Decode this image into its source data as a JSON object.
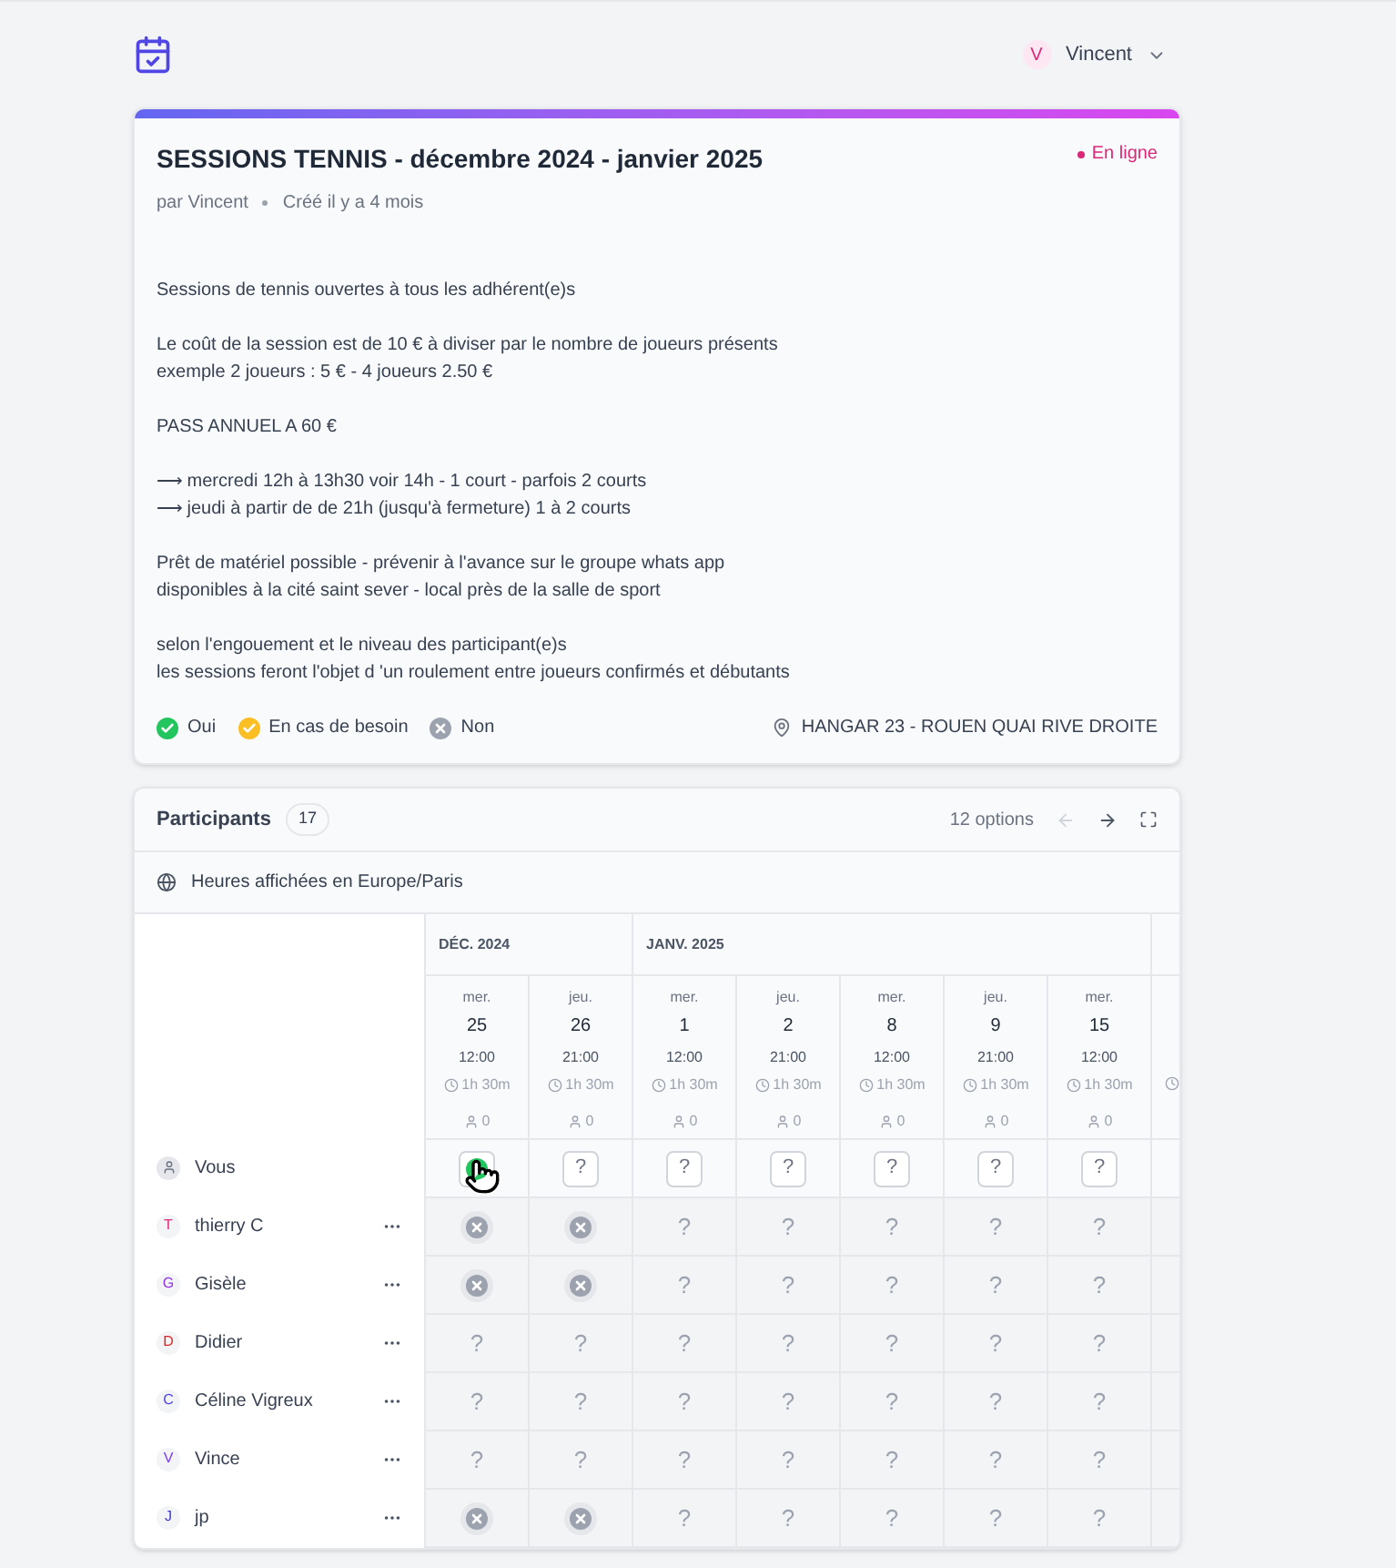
{
  "header": {
    "user": {
      "initial": "V",
      "name": "Vincent"
    }
  },
  "poll": {
    "title": "SESSIONS TENNIS - décembre 2024 - janvier 2025",
    "status": "En ligne",
    "author": "par Vincent",
    "created": "Créé il y a 4 mois",
    "description": [
      [
        "Sessions de tennis ouvertes à tous les adhérent(e)s"
      ],
      [
        "Le coût de la session est de 10 € à diviser par le nombre de joueurs présents",
        "exemple 2 joueurs : 5 € - 4 joueurs 2.50 €"
      ],
      [
        "PASS ANNUEL A 60 €"
      ],
      [
        "⟶ mercredi 12h à 13h30 voir 14h - 1 court - parfois 2 courts",
        "⟶ jeudi à partir de de 21h (jusqu'à fermeture) 1 à 2 courts"
      ],
      [
        "Prêt de matériel possible - prévenir à l'avance sur le groupe whats app",
        "disponibles à la cité saint sever - local près de la salle de sport"
      ],
      [
        "selon l'engouement et le niveau des participant(e)s",
        "les sessions feront l'objet d 'un roulement entre joueurs confirmés et débutants"
      ]
    ],
    "legend": [
      {
        "kind": "yes",
        "label": "Oui"
      },
      {
        "kind": "maybe",
        "label": "En cas de besoin"
      },
      {
        "kind": "no",
        "label": "Non"
      }
    ],
    "location": "HANGAR 23 - ROUEN QUAI RIVE DROITE"
  },
  "participants_panel": {
    "title": "Participants",
    "count": "17",
    "options_count": "12 options",
    "prev_disabled": true,
    "timezone": "Heures affichées en Europe/Paris",
    "months": [
      {
        "label": "DÉC. 2024",
        "options": [
          {
            "weekday": "mer.",
            "day": "25",
            "time": "12:00",
            "duration": "1h 30m",
            "attendees": "0"
          },
          {
            "weekday": "jeu.",
            "day": "26",
            "time": "21:00",
            "duration": "1h 30m",
            "attendees": "0"
          }
        ]
      },
      {
        "label": "JANV. 2025",
        "options": [
          {
            "weekday": "mer.",
            "day": "1",
            "time": "12:00",
            "duration": "1h 30m",
            "attendees": "0"
          },
          {
            "weekday": "jeu.",
            "day": "2",
            "time": "21:00",
            "duration": "1h 30m",
            "attendees": "0"
          },
          {
            "weekday": "mer.",
            "day": "8",
            "time": "12:00",
            "duration": "1h 30m",
            "attendees": "0"
          },
          {
            "weekday": "jeu.",
            "day": "9",
            "time": "21:00",
            "duration": "1h 30m",
            "attendees": "0"
          },
          {
            "weekday": "mer.",
            "day": "15",
            "time": "12:00",
            "duration": "1h 30m",
            "attendees": "0"
          }
        ]
      }
    ],
    "participants": [
      {
        "kind": "self",
        "name": "Vous",
        "responses": [
          {
            "kind": "yes"
          },
          {
            "kind": "pending",
            "text": "?"
          },
          {
            "kind": "pending",
            "text": "?"
          },
          {
            "kind": "pending",
            "text": "?"
          },
          {
            "kind": "pending",
            "text": "?"
          },
          {
            "kind": "pending",
            "text": "?"
          },
          {
            "kind": "pending",
            "text": "?"
          }
        ]
      },
      {
        "kind": "other",
        "initial": "T",
        "name": "thierry C",
        "color": "#db2777",
        "responses": [
          {
            "kind": "no"
          },
          {
            "kind": "no"
          },
          {
            "kind": "unknown",
            "text": "?"
          },
          {
            "kind": "unknown",
            "text": "?"
          },
          {
            "kind": "unknown",
            "text": "?"
          },
          {
            "kind": "unknown",
            "text": "?"
          },
          {
            "kind": "unknown",
            "text": "?"
          }
        ]
      },
      {
        "kind": "other",
        "initial": "G",
        "name": "Gisèle",
        "color": "#9333ea",
        "responses": [
          {
            "kind": "no"
          },
          {
            "kind": "no"
          },
          {
            "kind": "unknown",
            "text": "?"
          },
          {
            "kind": "unknown",
            "text": "?"
          },
          {
            "kind": "unknown",
            "text": "?"
          },
          {
            "kind": "unknown",
            "text": "?"
          },
          {
            "kind": "unknown",
            "text": "?"
          }
        ]
      },
      {
        "kind": "other",
        "initial": "D",
        "name": "Didier",
        "color": "#dc2626",
        "responses": [
          {
            "kind": "unknown",
            "text": "?"
          },
          {
            "kind": "unknown",
            "text": "?"
          },
          {
            "kind": "unknown",
            "text": "?"
          },
          {
            "kind": "unknown",
            "text": "?"
          },
          {
            "kind": "unknown",
            "text": "?"
          },
          {
            "kind": "unknown",
            "text": "?"
          },
          {
            "kind": "unknown",
            "text": "?"
          }
        ]
      },
      {
        "kind": "other",
        "initial": "C",
        "name": "Céline Vigreux",
        "color": "#4f46e5",
        "responses": [
          {
            "kind": "unknown",
            "text": "?"
          },
          {
            "kind": "unknown",
            "text": "?"
          },
          {
            "kind": "unknown",
            "text": "?"
          },
          {
            "kind": "unknown",
            "text": "?"
          },
          {
            "kind": "unknown",
            "text": "?"
          },
          {
            "kind": "unknown",
            "text": "?"
          },
          {
            "kind": "unknown",
            "text": "?"
          }
        ]
      },
      {
        "kind": "other",
        "initial": "V",
        "name": "Vince",
        "color": "#7c3aed",
        "responses": [
          {
            "kind": "unknown",
            "text": "?"
          },
          {
            "kind": "unknown",
            "text": "?"
          },
          {
            "kind": "unknown",
            "text": "?"
          },
          {
            "kind": "unknown",
            "text": "?"
          },
          {
            "kind": "unknown",
            "text": "?"
          },
          {
            "kind": "unknown",
            "text": "?"
          },
          {
            "kind": "unknown",
            "text": "?"
          }
        ]
      },
      {
        "kind": "other",
        "initial": "J",
        "name": "jp",
        "color": "#4338ca",
        "responses": [
          {
            "kind": "no"
          },
          {
            "kind": "no"
          },
          {
            "kind": "unknown",
            "text": "?"
          },
          {
            "kind": "unknown",
            "text": "?"
          },
          {
            "kind": "unknown",
            "text": "?"
          },
          {
            "kind": "unknown",
            "text": "?"
          },
          {
            "kind": "unknown",
            "text": "?"
          }
        ]
      }
    ]
  }
}
